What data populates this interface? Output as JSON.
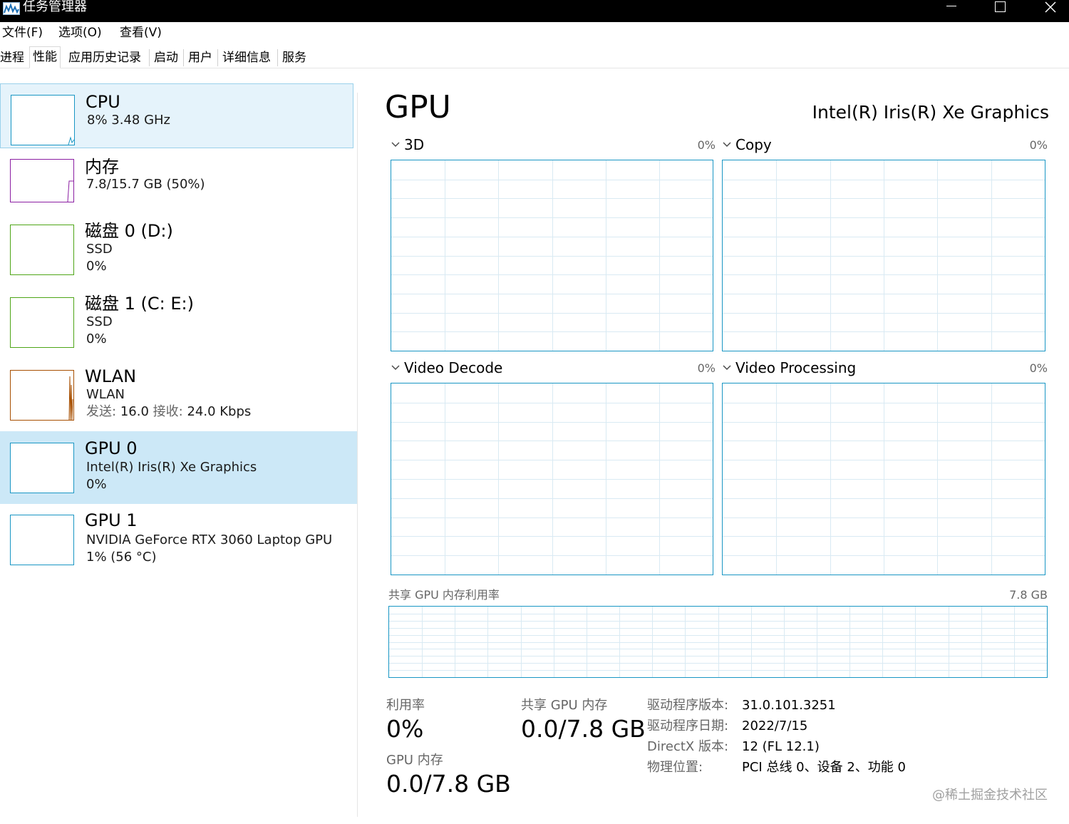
{
  "window": {
    "title": "任务管理器",
    "app_icon": "task-manager-icon",
    "controls": [
      "minimize-icon",
      "maximize-icon",
      "close-icon"
    ]
  },
  "menu": [
    "文件(F)",
    "选项(O)",
    "查看(V)"
  ],
  "tabs": [
    "进程",
    "性能",
    "应用历史记录",
    "启动",
    "用户",
    "详细信息",
    "服务"
  ],
  "active_tab": "性能",
  "sidebar": {
    "items": [
      {
        "title": "CPU",
        "lines": [
          "8%  3.48 GHz"
        ],
        "color": "#1996c4"
      },
      {
        "title": "内存",
        "lines": [
          "7.8/15.7 GB (50%)"
        ],
        "color": "#8b1ea2"
      },
      {
        "title": "磁盘 0 (D:)",
        "lines": [
          "SSD",
          "0%"
        ],
        "color": "#4ea517"
      },
      {
        "title": "磁盘 1 (C: E:)",
        "lines": [
          "SSD",
          "0%"
        ],
        "color": "#4ea517"
      },
      {
        "title": "WLAN",
        "lines": [
          "WLAN"
        ],
        "net_send_label": "发送:",
        "net_send": "16.0",
        "net_recv_label": "接收:",
        "net_recv": "24.0 Kbps",
        "color": "#a74f01"
      },
      {
        "title": "GPU 0",
        "lines": [
          "Intel(R) Iris(R) Xe Graphics",
          "0%"
        ],
        "color": "#1996c4"
      },
      {
        "title": "GPU 1",
        "lines": [
          "NVIDIA GeForce RTX 3060 Laptop GPU",
          "1%  (56 °C)"
        ],
        "color": "#1996c4"
      }
    ]
  },
  "main": {
    "title": "GPU",
    "gpu_name": "Intel(R) Iris(R) Xe Graphics",
    "engines": [
      {
        "name": "3D",
        "pct": "0%"
      },
      {
        "name": "Copy",
        "pct": "0%"
      },
      {
        "name": "Video Decode",
        "pct": "0%"
      },
      {
        "name": "Video Processing",
        "pct": "0%"
      }
    ],
    "shared_memory_label": "共享 GPU 内存利用率",
    "shared_memory_max": "7.8 GB",
    "stats": {
      "utilization_label": "利用率",
      "utilization_value": "0%",
      "shared_gpu_memory_label": "共享 GPU 内存",
      "shared_gpu_memory_value": "0.0/7.8 GB",
      "gpu_memory_label": "GPU 内存",
      "gpu_memory_value": "0.0/7.8 GB"
    },
    "info": [
      {
        "label": "驱动程序版本:",
        "value": "31.0.101.3251"
      },
      {
        "label": "驱动程序日期:",
        "value": "2022/7/15"
      },
      {
        "label": "DirectX 版本:",
        "value": "12 (FL 12.1)"
      },
      {
        "label": "物理位置:",
        "value": "PCI 总线 0、设备 2、功能 0"
      }
    ],
    "graph_color": "#1996c4"
  },
  "watermark": "@稀土掘金技术社区"
}
